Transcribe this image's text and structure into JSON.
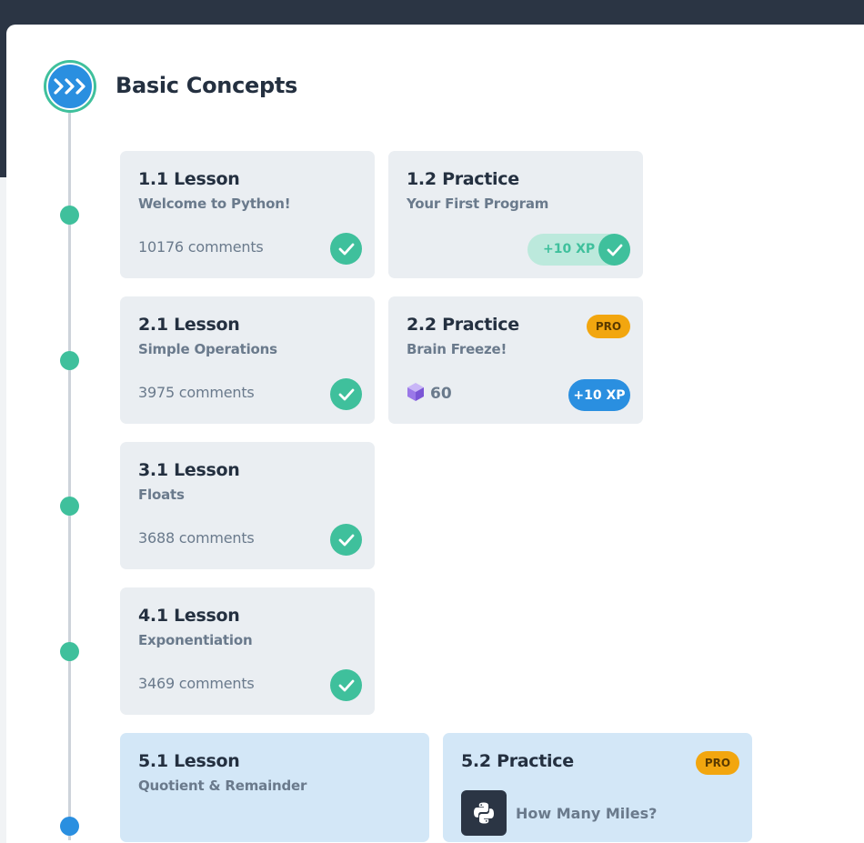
{
  "module": {
    "title": "Basic Concepts",
    "icon": "terminal-prompt-icon",
    "icon_text": ">>>"
  },
  "items": [
    {
      "title": "1.1 Lesson",
      "subtitle": "Welcome to Python!",
      "comments": "10176 comments",
      "status": "completed"
    },
    {
      "title": "1.2 Practice",
      "subtitle": "Your First Program",
      "xp": "+10 XP",
      "status": "completed"
    },
    {
      "title": "2.1 Lesson",
      "subtitle": "Simple Operations",
      "comments": "3975 comments",
      "status": "completed"
    },
    {
      "title": "2.2 Practice",
      "subtitle": "Brain Freeze!",
      "badge": "PRO",
      "gems": "60",
      "xp": "+10 XP",
      "status": "available"
    },
    {
      "title": "3.1 Lesson",
      "subtitle": "Floats",
      "comments": "3688 comments",
      "status": "completed"
    },
    {
      "title": "4.1 Lesson",
      "subtitle": "Exponentiation",
      "comments": "3469 comments",
      "status": "completed"
    },
    {
      "title": "5.1 Lesson",
      "subtitle": "Quotient & Remainder",
      "status": "current"
    },
    {
      "title": "5.2 Practice",
      "badge": "PRO",
      "task": "How Many Miles?",
      "task_icon": "python-logo-icon",
      "status": "current"
    }
  ],
  "colors": {
    "accent": "#2a8fe0",
    "done": "#3fc09c",
    "pro": "#f2a60f",
    "header": "#2b3544"
  }
}
